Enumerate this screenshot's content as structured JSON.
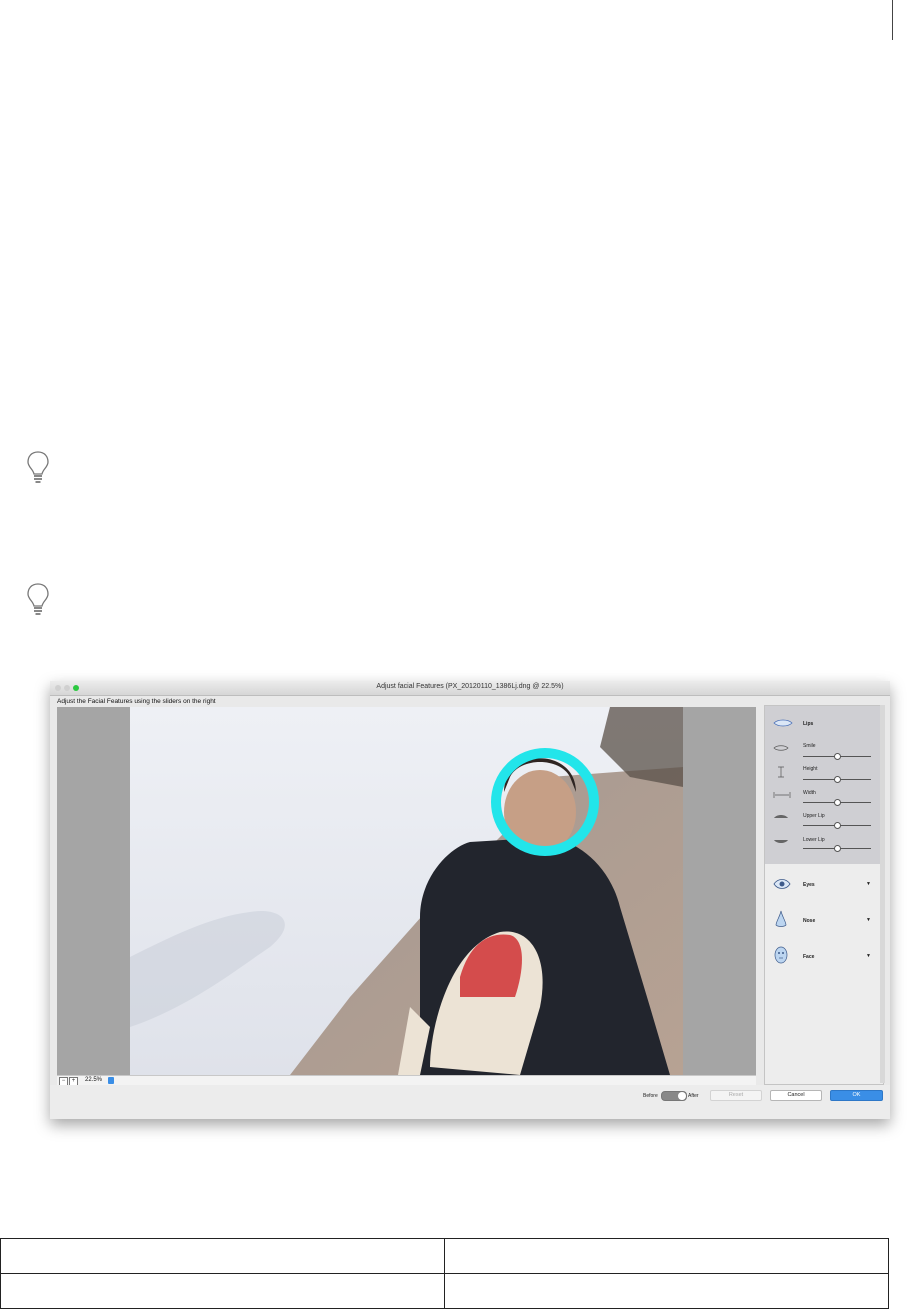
{
  "dialog": {
    "title": "Adjust facial Features (PX_20120110_1386Lj.dng @ 22.5%)",
    "instructions": "Adjust the Facial Features using the sliders on the right",
    "zoom": {
      "minus": "−",
      "plus": "+",
      "value": "22.5%"
    },
    "panel": {
      "group_label": "Lips",
      "sliders": [
        {
          "label": "Smile",
          "value": 0.5
        },
        {
          "label": "Height",
          "value": 0.5
        },
        {
          "label": "Width",
          "value": 0.5
        },
        {
          "label": "Upper Lip",
          "value": 0.5
        },
        {
          "label": "Lower Lip",
          "value": 0.5
        }
      ],
      "sections": [
        {
          "label": "Eyes",
          "arrow": "▼"
        },
        {
          "label": "Nose",
          "arrow": "▼"
        },
        {
          "label": "Face",
          "arrow": "▼"
        }
      ]
    },
    "footer": {
      "before_label": "Before",
      "after_label": "After",
      "reset_label": "Reset",
      "cancel_label": "Cancel",
      "ok_label": "OK"
    }
  },
  "colors": {
    "face_circle": "#22e5ea",
    "ok_button": "#3a8ee6"
  },
  "icons": [
    "lightbulb-icon",
    "lips-icon",
    "eye-icon",
    "nose-icon",
    "face-icon"
  ]
}
